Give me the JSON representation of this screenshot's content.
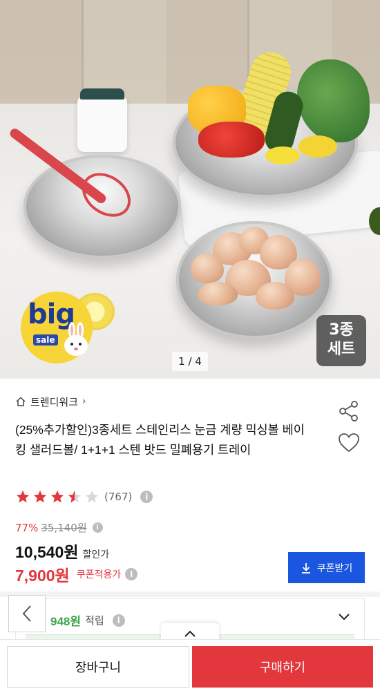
{
  "gallery": {
    "page_indicator": "1 / 4",
    "badge_big": "big",
    "badge_sale": "sale",
    "set_badge_line1": "3종",
    "set_badge_line2": "세트"
  },
  "store": {
    "name": "트렌디워크",
    "chevron": "›"
  },
  "product": {
    "title": "(25%추가할인)3종세트 스테인리스 눈금 계량 믹싱볼 베이킹 샐러드볼/ 1+1+1 스텐 밧드 밀폐용기 트레이",
    "rating": 3.5,
    "review_count": "(767)"
  },
  "pricing": {
    "discount_percent": "77%",
    "original_price": "35,140원",
    "sale_price": "10,540원",
    "sale_price_label": "할인가",
    "coupon_price": "7,900원",
    "coupon_price_label": "쿠폰적용가",
    "coupon_button": "쿠폰받기"
  },
  "points": {
    "value": "948원",
    "label": "적립"
  },
  "bottom_bar": {
    "cart_label": "장바구니",
    "buy_label": "구매하기"
  },
  "colors": {
    "accent_red": "#e2373c",
    "coupon_blue": "#1b56e0",
    "points_green": "#3aa64a"
  }
}
